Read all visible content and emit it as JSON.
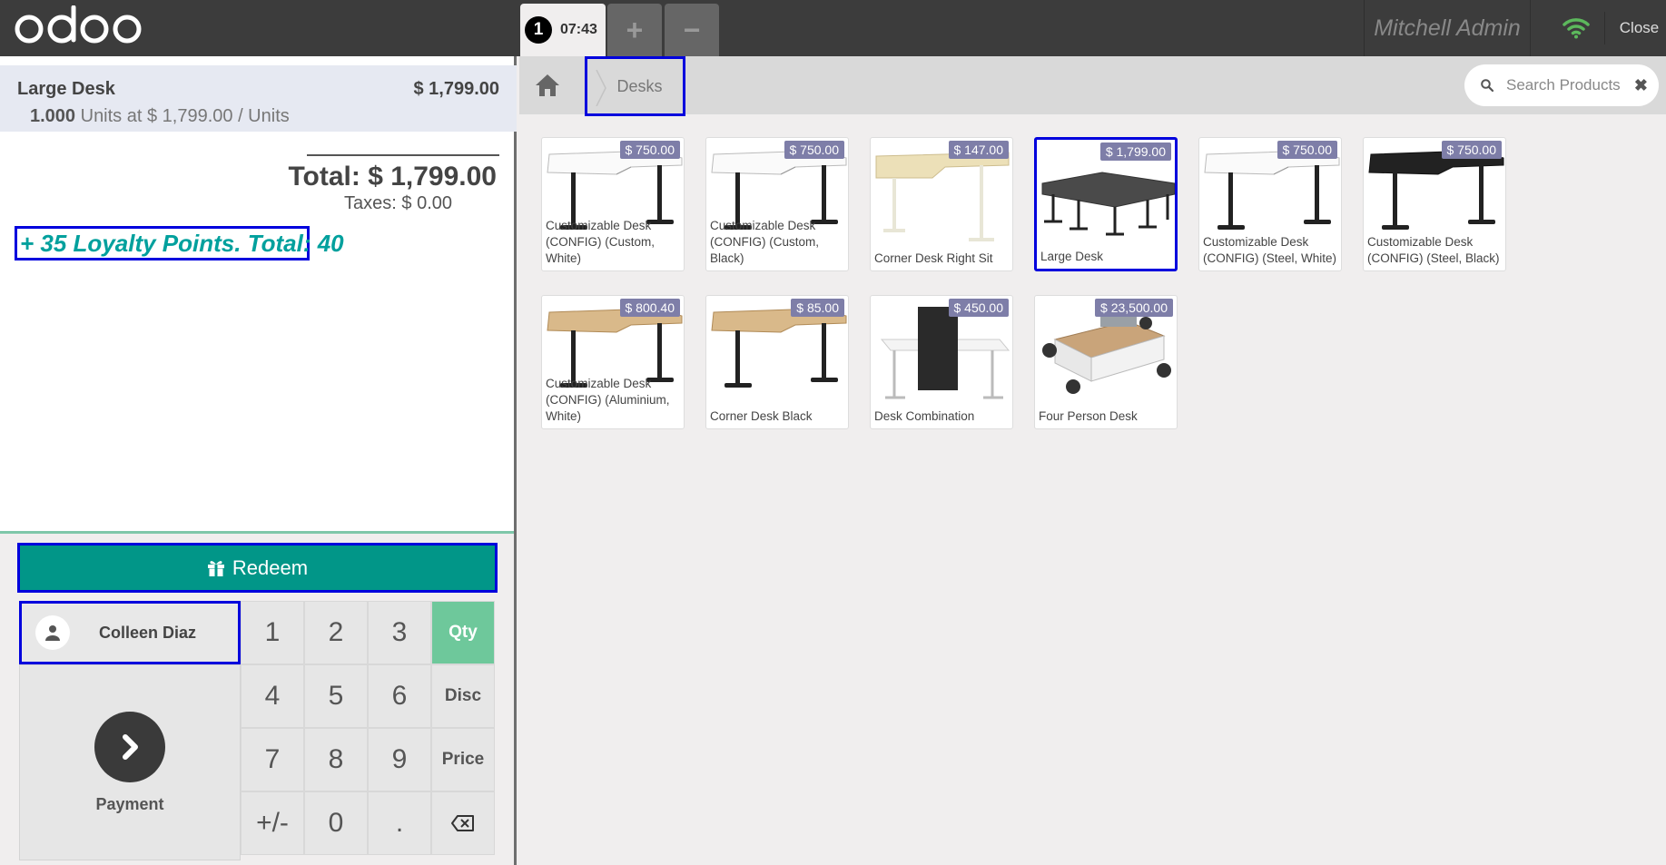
{
  "topbar": {
    "brand": "odoo",
    "order_number": "1",
    "order_time": "07:43",
    "add_order": "+",
    "remove_order": "−",
    "user": "Mitchell Admin",
    "close": "Close"
  },
  "order": {
    "line_name": "Large Desk",
    "line_price": "$ 1,799.00",
    "line_qty": "1.000",
    "line_detail": " Units at $ 1,799.00 / Units",
    "total": "Total: $ 1,799.00",
    "taxes": "Taxes: $ 0.00",
    "loyalty": "+ 35 Loyalty Points. Total: 40"
  },
  "controls": {
    "redeem": "Redeem",
    "customer": "Colleen Diaz",
    "payment": "Payment",
    "keys": [
      "1",
      "2",
      "3",
      "Qty",
      "4",
      "5",
      "6",
      "Disc",
      "7",
      "8",
      "9",
      "Price",
      "+/-",
      "0",
      "."
    ]
  },
  "breadcrumb": {
    "category": "Desks"
  },
  "search": {
    "placeholder": "Search Products"
  },
  "products": [
    {
      "name": "Customizable Desk (CONFIG) (Custom, White)",
      "price": "$ 750.00",
      "image": "white-desk"
    },
    {
      "name": "Customizable Desk (CONFIG) (Custom, Black)",
      "price": "$ 750.00",
      "image": "white-desk"
    },
    {
      "name": "Corner Desk Right Sit",
      "price": "$ 147.00",
      "image": "corner-cream"
    },
    {
      "name": "Large Desk",
      "price": "$ 1,799.00",
      "image": "large-desk"
    },
    {
      "name": "Customizable Desk (CONFIG) (Steel, White)",
      "price": "$ 750.00",
      "image": "white-desk"
    },
    {
      "name": "Customizable Desk (CONFIG) (Steel, Black)",
      "price": "$ 750.00",
      "image": "black-desk"
    },
    {
      "name": "Customizable Desk (CONFIG) (Aluminium, White)",
      "price": "$ 800.40",
      "image": "wood-desk"
    },
    {
      "name": "Corner Desk Black",
      "price": "$ 85.00",
      "image": "wood-desk"
    },
    {
      "name": "Desk Combination",
      "price": "$ 450.00",
      "image": "combo-desk"
    },
    {
      "name": "Four Person Desk",
      "price": "$ 23,500.00",
      "image": "four-desk"
    }
  ],
  "selected_product": "Large Desk",
  "colors": {
    "accent": "#019688",
    "highlight": "#0000dd",
    "price_tag": "#7e7ea8",
    "wifi": "#5cb85c"
  }
}
